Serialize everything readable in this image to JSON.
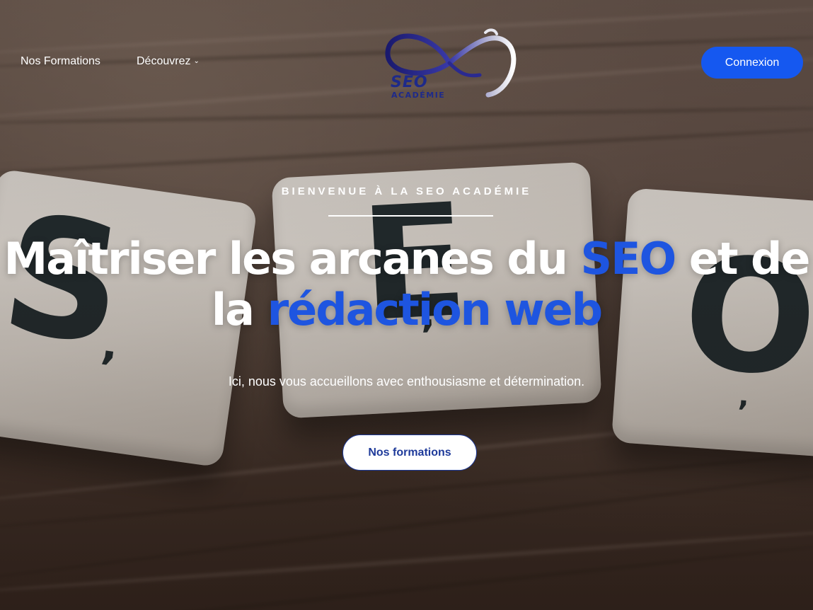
{
  "nav": {
    "formations_label": "Nos Formations",
    "decouvrez_label": "Découvrez",
    "decouvrez_chevron": "chevron-down-icon",
    "login_label": "Connexion"
  },
  "logo": {
    "line1": "SEO",
    "line2": "ACADÉMIE"
  },
  "hero": {
    "kicker": "BIENVENUE À LA SEO ACADÉMIE",
    "headline_part1": "Maîtriser les arcanes du ",
    "headline_accent1": "SEO",
    "headline_part2": " et de la ",
    "headline_accent2": "rédaction web",
    "subline": "Ici, nous vous accueillons avec enthousiasme et détermination.",
    "cta_label": "Nos formations"
  },
  "background_tiles": {
    "tile1": "S",
    "tile2": "E",
    "tile3": "O"
  },
  "colors": {
    "accent": "#1e55e0",
    "login_button": "#1558f0",
    "cta_text": "#1e3a9a",
    "logo_blue": "#1e2a8a"
  }
}
